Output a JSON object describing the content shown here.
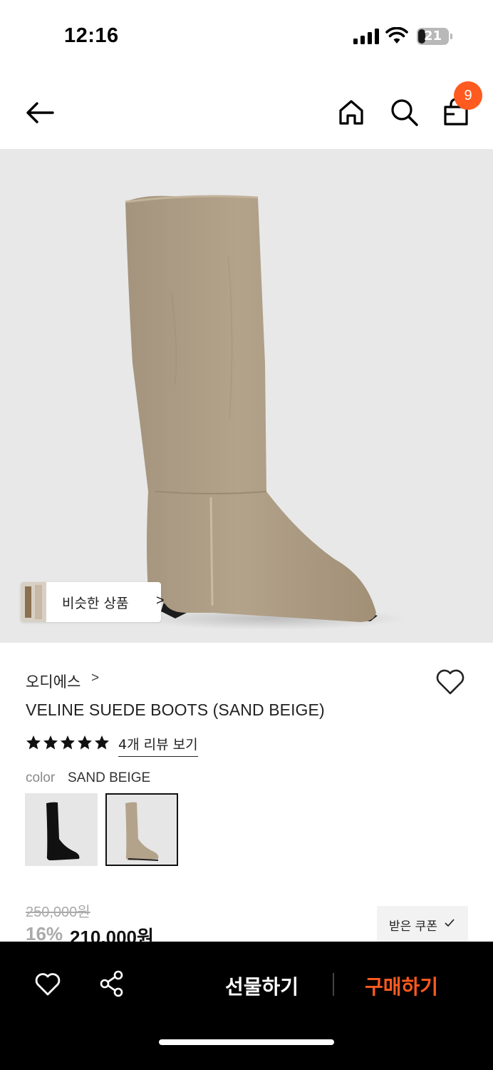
{
  "status_bar": {
    "time": "12:16",
    "battery": "21"
  },
  "header": {
    "cart_count": "9"
  },
  "hero": {
    "similar_label": "비슷한 상품",
    "similar_chevron": ">"
  },
  "product": {
    "brand": "오디에스",
    "brand_chevron": ">",
    "name": "VELINE SUEDE BOOTS (SAND BEIGE)",
    "rating": 5,
    "review_link": "4개 리뷰 보기",
    "color_label": "color",
    "color_value": "SAND BEIGE",
    "colors": [
      "black",
      "sand beige"
    ],
    "original_price": "250,000원",
    "discount": "16%",
    "price": "210,000원",
    "coupon_label": "받은 쿠폰"
  },
  "bottom_bar": {
    "gift_label": "선물하기",
    "buy_label": "구매하기"
  },
  "colors": {
    "accent": "#ff5a1f",
    "hero_bg": "#e8e8e8",
    "bar_bg": "#000000"
  }
}
